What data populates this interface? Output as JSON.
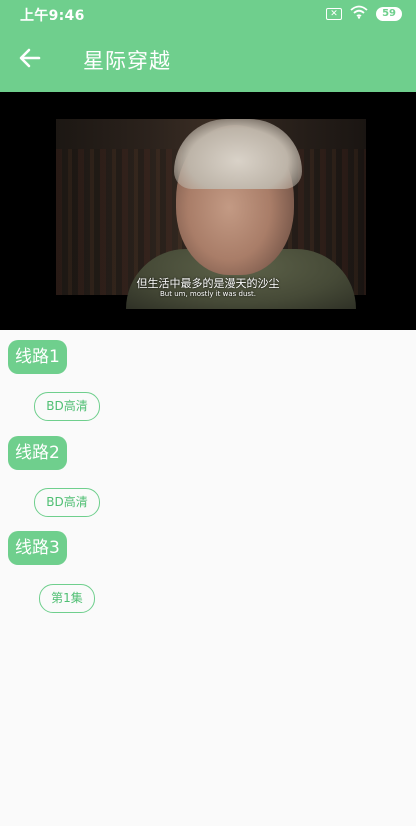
{
  "status_bar": {
    "time": "上午9:46",
    "battery": "59",
    "icons": [
      "sim-error-icon",
      "wifi-icon",
      "battery-icon"
    ]
  },
  "app_bar": {
    "title": "星际穿越",
    "back_icon": "arrow-left-icon"
  },
  "video": {
    "subtitle_cn": "但生活中最多的是漫天的沙尘",
    "subtitle_en": "But um, mostly it was dust."
  },
  "lines": [
    {
      "label": "线路1",
      "episodes": [
        "BD高清"
      ]
    },
    {
      "label": "线路2",
      "episodes": [
        "BD高清"
      ]
    },
    {
      "label": "线路3",
      "episodes": [
        "第1集"
      ]
    }
  ],
  "colors": {
    "accent": "#6fcf8d",
    "background": "#fafafa",
    "video_bg": "#000000"
  }
}
